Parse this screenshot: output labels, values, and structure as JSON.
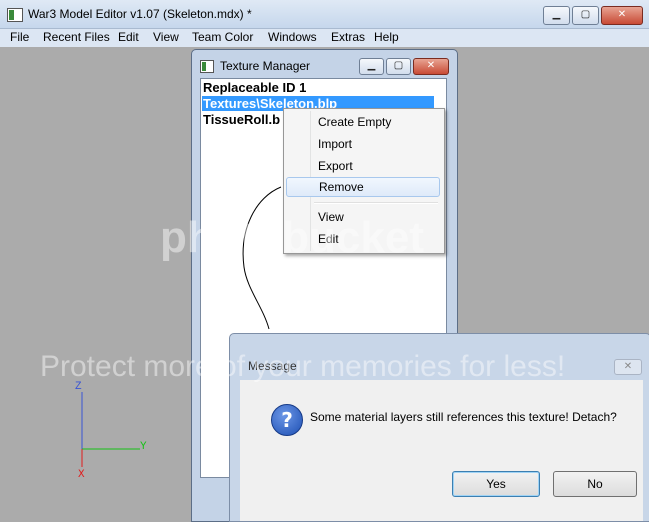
{
  "window": {
    "title": "War3 Model Editor v1.07 (Skeleton.mdx) *"
  },
  "caption_buttons": {
    "minimize": "▁",
    "maximize": "▢",
    "close": "✕"
  },
  "menu": [
    "File",
    "Recent Files",
    "Edit",
    "View",
    "Team Color",
    "Windows",
    "Extras",
    "Help"
  ],
  "texture_manager": {
    "title": "Texture Manager",
    "items": [
      "Replaceable ID 1",
      "Textures\\Skeleton.blp",
      "TissueRoll.b"
    ],
    "selected_index": 1
  },
  "context_menu": {
    "items": [
      "Create Empty",
      "Import",
      "Export",
      "Remove",
      "View",
      "Edit"
    ],
    "highlighted": "Remove"
  },
  "message_box": {
    "title": "Message",
    "close": "✕",
    "icon": "question-icon",
    "icon_glyph": "?",
    "text": "Some material layers still references this texture! Detach?",
    "yes_label": "Yes",
    "no_label": "No"
  },
  "axes": {
    "z": "Z",
    "y": "Y",
    "x": "X",
    "z_color": "#3a55d4",
    "y_color": "#14c214",
    "x_color": "#e01d1d"
  },
  "watermark": {
    "top": "Protect more of your memories for less!",
    "logo": "photobucket"
  }
}
